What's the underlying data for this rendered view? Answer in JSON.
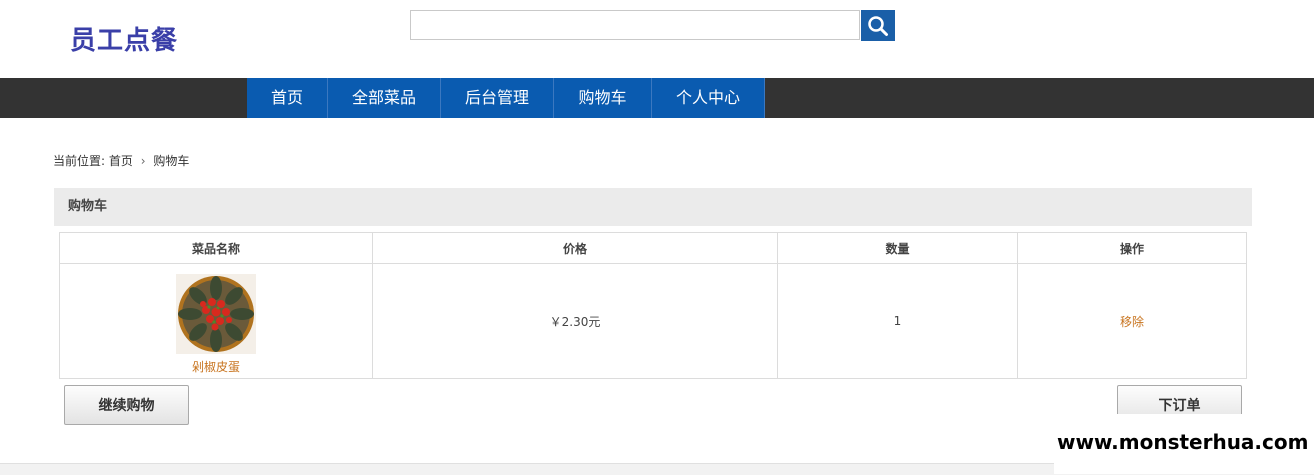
{
  "header": {
    "logo": "员工点餐",
    "search": {
      "value": "",
      "placeholder": ""
    }
  },
  "nav": {
    "items": [
      {
        "label": "首页"
      },
      {
        "label": "全部菜品"
      },
      {
        "label": "后台管理"
      },
      {
        "label": "购物车"
      },
      {
        "label": "个人中心"
      }
    ]
  },
  "breadcrumb": {
    "prefix": "当前位置:",
    "home": "首页",
    "separator": "›",
    "current": "购物车"
  },
  "cart": {
    "title": "购物车",
    "columns": [
      "菜品名称",
      "价格",
      "数量",
      "操作"
    ],
    "items": [
      {
        "name": "剁椒皮蛋",
        "price": "￥2.30元",
        "quantity": "1",
        "action": "移除"
      }
    ],
    "continue_label": "继续购物",
    "order_label": "下订单"
  },
  "watermark": "www.monsterhua.com",
  "colors": {
    "logo": "#3a3fa8",
    "nav_bg": "#333333",
    "nav_item": "#0a5bb0",
    "link": "#c8741f"
  }
}
